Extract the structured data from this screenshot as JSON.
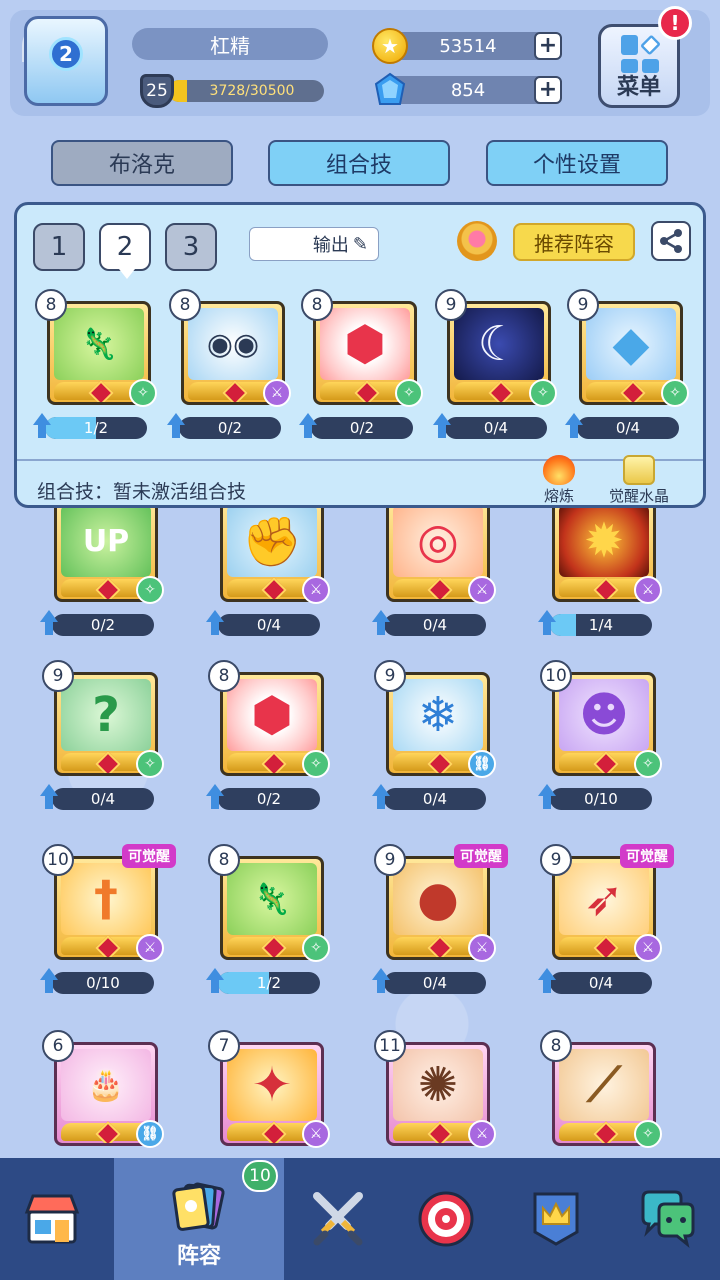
{
  "player": {
    "rank": "2",
    "name": "杠精",
    "level": "25",
    "xp_text": "3728/30500",
    "xp_fraction": 0.122
  },
  "currency": {
    "gold": "53514",
    "gems": "854"
  },
  "menu": {
    "label": "菜单",
    "alert": "!"
  },
  "tabs": {
    "block": "布洛克",
    "combo": "组合技",
    "custom": "个性设置"
  },
  "deck": {
    "slots": [
      "1",
      "2",
      "3"
    ],
    "selected_slot": "2",
    "output_label": "输出",
    "recommend": "推荐阵容",
    "combo_status": "组合技：暂未激活组合技",
    "smelt_label": "熔炼",
    "crystal_label": "觉醒水晶",
    "cards": [
      {
        "level": "8",
        "progress": "1/2",
        "fill": 0.5,
        "art": "chameleon",
        "type": "green"
      },
      {
        "level": "8",
        "progress": "0/2",
        "fill": 0,
        "art": "robot",
        "type": "purple"
      },
      {
        "level": "8",
        "progress": "0/2",
        "fill": 0,
        "art": "hex",
        "type": "green"
      },
      {
        "level": "9",
        "progress": "0/4",
        "fill": 0,
        "art": "moon",
        "type": "green"
      },
      {
        "level": "9",
        "progress": "0/4",
        "fill": 0,
        "art": "crystal",
        "type": "green"
      }
    ]
  },
  "collection": [
    {
      "level": "",
      "progress": "0/2",
      "fill": 0,
      "art": "up",
      "type": "green",
      "awaken": ""
    },
    {
      "level": "",
      "progress": "0/4",
      "fill": 0,
      "art": "fist",
      "type": "purple",
      "awaken": ""
    },
    {
      "level": "",
      "progress": "0/4",
      "fill": 0,
      "art": "target",
      "type": "purple",
      "awaken": ""
    },
    {
      "level": "",
      "progress": "1/4",
      "fill": 0.25,
      "art": "sun",
      "type": "purple",
      "awaken": ""
    },
    {
      "level": "9",
      "progress": "0/4",
      "fill": 0,
      "art": "poison",
      "type": "green",
      "awaken": ""
    },
    {
      "level": "8",
      "progress": "0/2",
      "fill": 0,
      "art": "hex",
      "type": "green",
      "awaken": ""
    },
    {
      "level": "9",
      "progress": "0/4",
      "fill": 0,
      "art": "ice",
      "type": "blue",
      "awaken": ""
    },
    {
      "level": "10",
      "progress": "0/10",
      "fill": 0,
      "art": "demon",
      "type": "green",
      "awaken": ""
    },
    {
      "level": "10",
      "progress": "0/10",
      "fill": 0,
      "art": "sword",
      "type": "purple",
      "awaken": "可觉醒"
    },
    {
      "level": "8",
      "progress": "1/2",
      "fill": 0.5,
      "art": "chameleon",
      "type": "green",
      "awaken": ""
    },
    {
      "level": "9",
      "progress": "0/4",
      "fill": 0,
      "art": "bomb",
      "type": "purple",
      "awaken": "可觉醒"
    },
    {
      "level": "9",
      "progress": "0/4",
      "fill": 0,
      "art": "rocket",
      "type": "purple",
      "awaken": "可觉醒"
    },
    {
      "level": "6",
      "progress": "",
      "fill": 0,
      "art": "cake",
      "type": "blue",
      "awaken": ""
    },
    {
      "level": "7",
      "progress": "",
      "fill": 0,
      "art": "fire",
      "type": "purple",
      "awaken": ""
    },
    {
      "level": "11",
      "progress": "",
      "fill": 0,
      "art": "burst",
      "type": "purple",
      "awaken": ""
    },
    {
      "level": "8",
      "progress": "",
      "fill": 0,
      "art": "sticks",
      "type": "green",
      "awaken": ""
    }
  ],
  "nav": {
    "items": [
      {
        "icon": "shop-icon"
      },
      {
        "icon": "cards-icon",
        "label": "阵容"
      },
      {
        "icon": "swords-icon"
      },
      {
        "icon": "target-icon"
      },
      {
        "icon": "crown-banner-icon"
      },
      {
        "icon": "chat-icon"
      }
    ],
    "cards_badge": "10"
  },
  "colors": {
    "background": "#b9cdf2",
    "nav": "#2d4a85",
    "accent_blue": "#7fd0f6",
    "gold": "#f3c41e",
    "awaken_tag": "#d23ac9"
  }
}
